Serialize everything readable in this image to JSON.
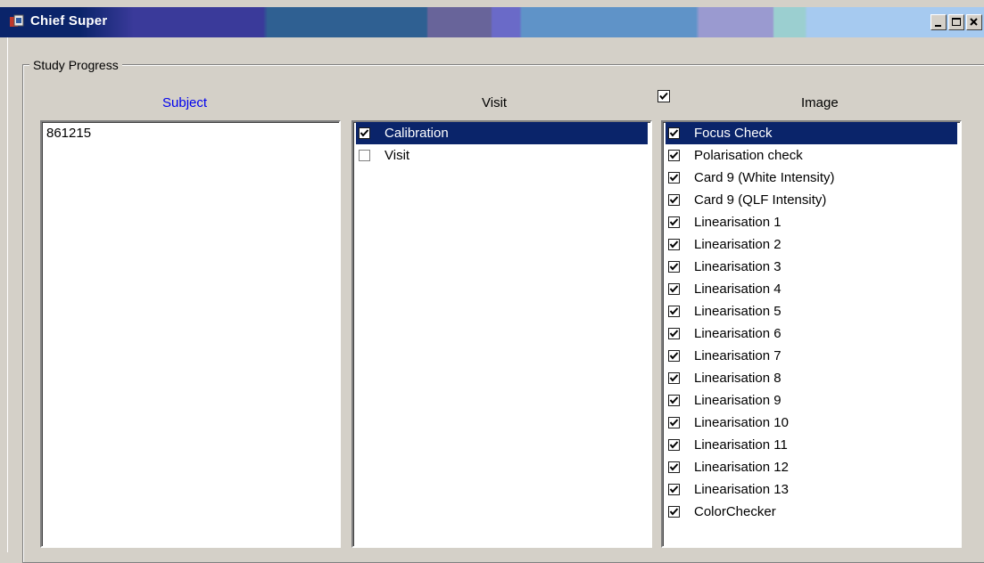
{
  "window": {
    "title": "Chief Super"
  },
  "group": {
    "label": "Study Progress"
  },
  "columns": {
    "subject": "Subject",
    "visit": "Visit",
    "image": "Image"
  },
  "header_checkbox": {
    "checked": true
  },
  "subjects": [
    {
      "label": "861215"
    }
  ],
  "visits": [
    {
      "label": "Calibration",
      "checked": true,
      "selected": true
    },
    {
      "label": "Visit",
      "checked": false,
      "selected": false
    }
  ],
  "images": [
    {
      "label": "Focus Check",
      "checked": true,
      "selected": true
    },
    {
      "label": "Polarisation check",
      "checked": true
    },
    {
      "label": "Card 9 (White Intensity)",
      "checked": true
    },
    {
      "label": "Card 9 (QLF Intensity)",
      "checked": true
    },
    {
      "label": "Linearisation 1",
      "checked": true
    },
    {
      "label": "Linearisation 2",
      "checked": true
    },
    {
      "label": "Linearisation 3",
      "checked": true
    },
    {
      "label": "Linearisation 4",
      "checked": true
    },
    {
      "label": "Linearisation 5",
      "checked": true
    },
    {
      "label": "Linearisation 6",
      "checked": true
    },
    {
      "label": "Linearisation 7",
      "checked": true
    },
    {
      "label": "Linearisation 8",
      "checked": true
    },
    {
      "label": "Linearisation 9",
      "checked": true
    },
    {
      "label": "Linearisation 10",
      "checked": true
    },
    {
      "label": "Linearisation 11",
      "checked": true
    },
    {
      "label": "Linearisation 12",
      "checked": true
    },
    {
      "label": "Linearisation 13",
      "checked": true
    },
    {
      "label": "ColorChecker",
      "checked": true
    }
  ],
  "colors": {
    "selection": "#0a246a",
    "subject_header": "#0000ee"
  }
}
